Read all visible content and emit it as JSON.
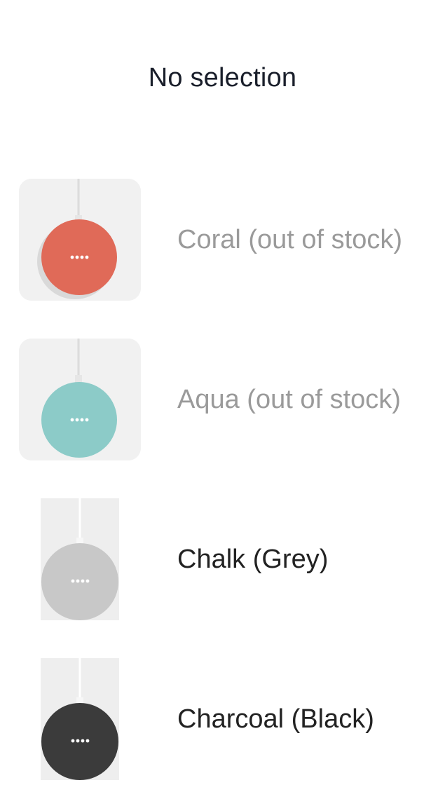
{
  "header": {
    "title": "No selection"
  },
  "options": [
    {
      "label": "Coral (out of stock)",
      "available": false,
      "color": "#e06a58",
      "image": "google-home-mini-coral"
    },
    {
      "label": "Aqua (out of stock)",
      "available": false,
      "color": "#8ccbc8",
      "image": "google-home-mini-aqua"
    },
    {
      "label": "Chalk (Grey)",
      "available": true,
      "color": "#c8c8c8",
      "image": "google-home-mini-chalk"
    },
    {
      "label": "Charcoal (Black)",
      "available": true,
      "color": "#3b3b3b",
      "image": "google-home-mini-charcoal"
    }
  ]
}
